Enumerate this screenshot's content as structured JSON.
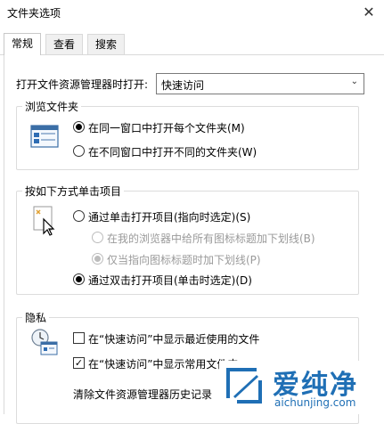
{
  "window": {
    "title": "文件夹选项",
    "close": "✕"
  },
  "tabs": [
    "常规",
    "查看",
    "搜索"
  ],
  "open_row": {
    "label": "打开文件资源管理器时打开:",
    "value": "快速访问",
    "arrow": "⌄"
  },
  "browse": {
    "title": "浏览文件夹",
    "options": [
      "在同一窗口中打开每个文件夹(M)",
      "在不同窗口中打开不同的文件夹(W)"
    ]
  },
  "click": {
    "title": "按如下方式单击项目",
    "single": "通过单击打开项目(指向时选定)(S)",
    "sub1": "在我的浏览器中给所有图标标题加下划线(B)",
    "sub2": "仅当指向图标标题时加下划线(P)",
    "double": "通过双击打开项目(单击时选定)(D)"
  },
  "privacy": {
    "title": "隐私",
    "check1": "在“快速访问”中显示最近使用的文件",
    "check2": "在“快速访问”中显示常用文件夹",
    "clear": "清除文件资源管理器历史记录"
  },
  "watermark": {
    "name": "爱纯净",
    "url": "aichunjing.com"
  },
  "colors": {
    "accent": "#1f6fb5",
    "border": "#dcdcdc"
  }
}
